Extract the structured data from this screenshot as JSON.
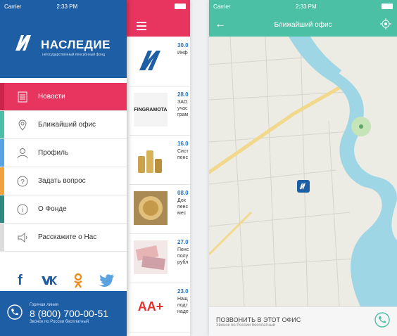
{
  "status": {
    "carrier": "Carrier",
    "time": "2:33 PM"
  },
  "drawer": {
    "brand_name": "НАСЛЕДИЕ",
    "brand_sub": "негосударственный пенсионный фонд",
    "menu": [
      {
        "label": "Новости",
        "icon": "news-icon",
        "bar": "#e8355f"
      },
      {
        "label": "Ближайший офис",
        "icon": "location-pin-icon",
        "bar": "#4cc0a5"
      },
      {
        "label": "Профиль",
        "icon": "user-icon",
        "bar": "#5aa3e0"
      },
      {
        "label": "Задать вопрос",
        "icon": "question-icon",
        "bar": "#f2a23c"
      },
      {
        "label": "О Фонде",
        "icon": "info-icon",
        "bar": "#2e8a7e"
      },
      {
        "label": "Расскажите о Нас",
        "icon": "megaphone-icon",
        "bar": "#dddddd"
      }
    ],
    "hotline": {
      "label": "Горячая линия",
      "number": "8 (800) 700-00-51",
      "note": "Звонок по России бесплатный"
    }
  },
  "feed": {
    "items": [
      {
        "date": "30.0",
        "text": "Инф"
      },
      {
        "date": "28.0",
        "text": "ЗАО учас грам"
      },
      {
        "date": "16.0",
        "text": "Сист пенс"
      },
      {
        "date": "08.0",
        "text": "Дох пенс мес"
      },
      {
        "date": "27.0",
        "text": "Пенс полу рубл"
      },
      {
        "date": "23.0",
        "text": "Нащ подт наде"
      }
    ],
    "thumb_labels": {
      "fingramota": "FINGRAMOTA",
      "aaplus": "AA+"
    }
  },
  "office": {
    "time": "2:33 PM",
    "title": "Ближайший офис",
    "call_label": "ПОЗВОНИТЬ В ЭТОТ ОФИС",
    "call_note": "Звонок по России бесплатный"
  },
  "colors": {
    "blue": "#1e5ea5",
    "pink": "#e8355f",
    "teal": "#4cc0a5"
  }
}
